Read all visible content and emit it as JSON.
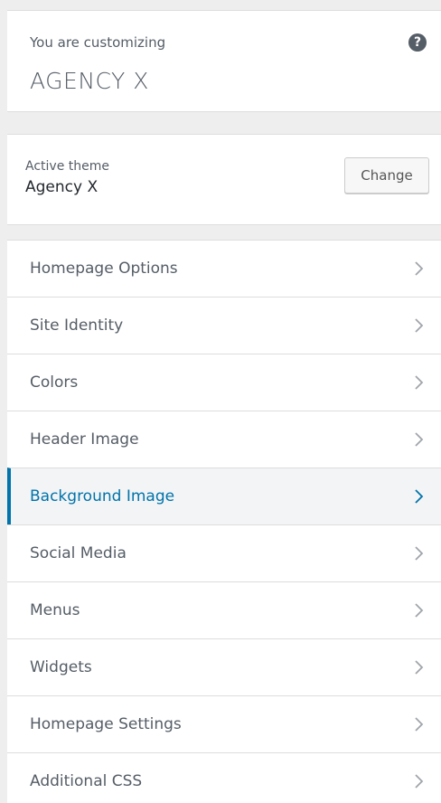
{
  "header": {
    "customizing_label": "You are customizing",
    "site_title": "AGENCY X",
    "help_icon": "question-circle-icon"
  },
  "theme": {
    "active_label": "Active theme",
    "name": "Agency X",
    "change_label": "Change"
  },
  "menu": {
    "items": [
      {
        "label": "Homepage Options"
      },
      {
        "label": "Site Identity"
      },
      {
        "label": "Colors"
      },
      {
        "label": "Header Image"
      },
      {
        "label": "Background Image",
        "active": true
      },
      {
        "label": "Social Media"
      },
      {
        "label": "Menus"
      },
      {
        "label": "Widgets"
      },
      {
        "label": "Homepage Settings"
      },
      {
        "label": "Additional CSS"
      }
    ]
  },
  "colors": {
    "accent": "#0073aa",
    "text": "#555d66",
    "background": "#eeeeee"
  }
}
